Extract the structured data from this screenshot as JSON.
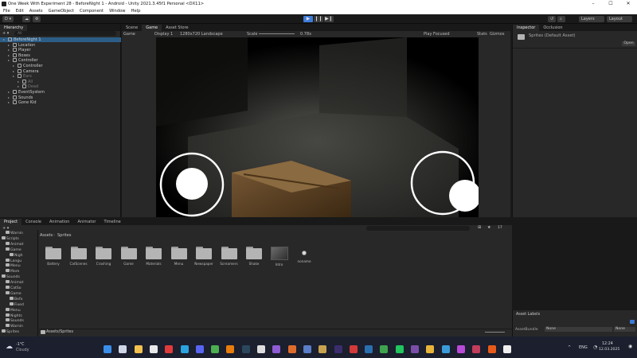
{
  "window": {
    "title": "One Week With Experiment 28 - BeforeNight 1 - Android - Unity 2021.3.45f1 Personal <DX11>",
    "controls": [
      "–",
      "☐",
      "✕"
    ]
  },
  "menubar": [
    "File",
    "Edit",
    "Assets",
    "GameObject",
    "Component",
    "Window",
    "Help"
  ],
  "toolbar": {
    "account": "D ▾",
    "layers": "Layers",
    "layout": "Layout",
    "play": "▶",
    "pause": "❙❙",
    "step": "▶❙"
  },
  "hierarchy": {
    "tab": "Hierarchy",
    "add": "+ ▾",
    "search_placeholder": "All",
    "items": [
      {
        "label": "BeforeNight 1",
        "indent": 0,
        "dim": false
      },
      {
        "label": "Location",
        "indent": 1,
        "dim": false
      },
      {
        "label": "Player",
        "indent": 1,
        "dim": false
      },
      {
        "label": "Boxes",
        "indent": 1,
        "dim": false
      },
      {
        "label": "Controller",
        "indent": 1,
        "dim": false
      },
      {
        "label": "Controller",
        "indent": 2,
        "dim": false
      },
      {
        "label": "Camera",
        "indent": 2,
        "dim": false
      },
      {
        "label": "Ears",
        "indent": 2,
        "dim": true
      },
      {
        "label": "All",
        "indent": 3,
        "dim": true
      },
      {
        "label": "Dead",
        "indent": 3,
        "dim": true
      },
      {
        "label": "EventSystem",
        "indent": 1,
        "dim": false
      },
      {
        "label": "Sounds",
        "indent": 1,
        "dim": false
      },
      {
        "label": "Gone Kid",
        "indent": 1,
        "dim": false
      }
    ]
  },
  "scene_tabs": [
    "Scene",
    "Game",
    "Asset Store"
  ],
  "game_bar": {
    "mode": "Game",
    "display": "Display 1",
    "resolution": "1280x720 Landscape",
    "scale_label": "Scale",
    "scale_value": "0.78x",
    "play_focused": "Play Focused",
    "stats": "Stats",
    "gizmos": "Gizmos"
  },
  "inspector": {
    "tabs": [
      "Inspector",
      "Occlusion"
    ],
    "asset_name": "Sprites (Default Asset)",
    "open_button": "Open",
    "asset_labels": "Asset Labels",
    "assetbundle_label": "AssetBundle",
    "assetbundle_value": "None",
    "variant_value": "None"
  },
  "project": {
    "tabs": [
      "Project",
      "Console",
      "Animation",
      "Animator",
      "Timeline"
    ],
    "breadcrumb": [
      "Assets",
      "Sprites"
    ],
    "path": "Assets/Sprites",
    "count_badge": "17",
    "assets": [
      {
        "label": "Battery",
        "kind": "folder"
      },
      {
        "label": "CatScenes",
        "kind": "folder"
      },
      {
        "label": "Crashing",
        "kind": "folder"
      },
      {
        "label": "Game",
        "kind": "folder"
      },
      {
        "label": "Materials",
        "kind": "folder"
      },
      {
        "label": "Menu",
        "kind": "folder"
      },
      {
        "label": "Newspaper",
        "kind": "folder"
      },
      {
        "label": "Screamers",
        "kind": "folder"
      },
      {
        "label": "Shake",
        "kind": "folder"
      },
      {
        "label": "Intro",
        "kind": "image"
      },
      {
        "label": "noname",
        "kind": "dot"
      }
    ],
    "tree": [
      {
        "label": "Warnin",
        "indent": 1
      },
      {
        "label": "Scripts",
        "indent": 0
      },
      {
        "label": "Animat",
        "indent": 1
      },
      {
        "label": "Game",
        "indent": 1
      },
      {
        "label": "Nigh",
        "indent": 2
      },
      {
        "label": "Langu",
        "indent": 1
      },
      {
        "label": "Menu",
        "indent": 1
      },
      {
        "label": "More",
        "indent": 1
      },
      {
        "label": "Sounds",
        "indent": 0
      },
      {
        "label": "Animat",
        "indent": 1
      },
      {
        "label": "CatSo",
        "indent": 1
      },
      {
        "label": "Game",
        "indent": 1
      },
      {
        "label": "Befo",
        "indent": 2
      },
      {
        "label": "Fixed",
        "indent": 2
      },
      {
        "label": "Menu",
        "indent": 1
      },
      {
        "label": "Nights",
        "indent": 1
      },
      {
        "label": "Sounds",
        "indent": 1
      },
      {
        "label": "Warnin",
        "indent": 1
      },
      {
        "label": "Sprites",
        "indent": 0
      }
    ]
  },
  "taskbar": {
    "weather_temp": "-1°C",
    "weather_text": "Cloudy",
    "lang": "ENG",
    "time": "12:24",
    "date": "12.03.2025"
  },
  "colors": {
    "accent": "#3d7bd9",
    "panel": "#282828",
    "taskbar": "#1b1f2e"
  }
}
